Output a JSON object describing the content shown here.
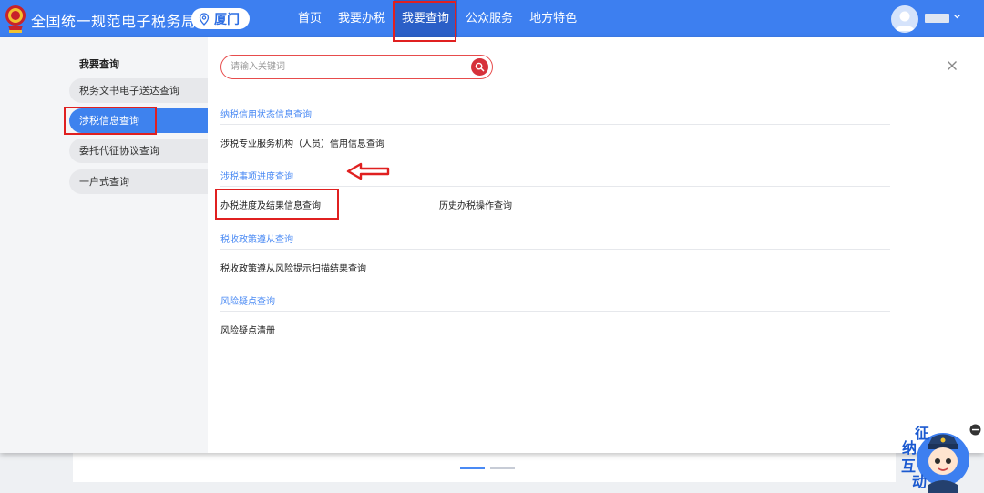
{
  "header": {
    "site_title": "全国统一规范电子税务局",
    "city": "厦门",
    "nav": [
      "首页",
      "我要办税",
      "我要查询",
      "公众服务",
      "地方特色"
    ],
    "active_nav_index": 2
  },
  "sidebar": {
    "title": "我要查询",
    "items": [
      {
        "label": "税务文书电子送达查询"
      },
      {
        "label": "涉税信息查询"
      },
      {
        "label": "委托代征协议查询"
      },
      {
        "label": "一户式查询"
      }
    ],
    "active_index": 1
  },
  "search": {
    "placeholder": "请输入关键词",
    "value": ""
  },
  "sections": [
    {
      "title": "纳税信用状态信息查询",
      "links": [
        "涉税专业服务机构（人员）信用信息查询"
      ]
    },
    {
      "title": "涉税事项进度查询",
      "links": [
        "办税进度及结果信息查询",
        "历史办税操作查询"
      ]
    },
    {
      "title": "税收政策遵从查询",
      "links": [
        "税收政策遵从风险提示扫描结果查询"
      ]
    },
    {
      "title": "风险疑点查询",
      "links": [
        "风险疑点清册"
      ]
    }
  ],
  "mascot": {
    "text": [
      "征",
      "纳",
      "互",
      "动"
    ]
  },
  "colors": {
    "nav_bg": "#3d7ff0",
    "nav_active": "#2b5fc7",
    "accent": "#3e82ee",
    "section_title": "#4a8af4",
    "annotation": "#e02020"
  }
}
